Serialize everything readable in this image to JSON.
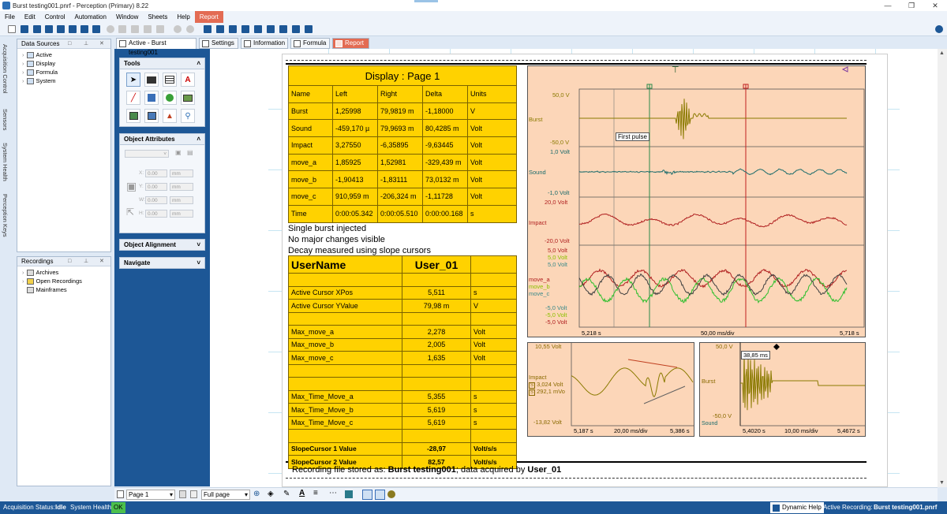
{
  "app": {
    "title": "Burst testing001.pnrf - Perception (Primary) 8.22",
    "menus": [
      "File",
      "Edit",
      "Control",
      "Automation",
      "Window",
      "Sheets",
      "Help",
      "Report"
    ]
  },
  "side_tabs": [
    "Acquisition Control",
    "Sensors",
    "System Health",
    "Perception Keys"
  ],
  "data_sources": {
    "title": "Data Sources",
    "items": [
      "Active",
      "Display",
      "Formula",
      "System"
    ]
  },
  "recordings": {
    "title": "Recordings",
    "items": [
      "Archives",
      "Open Recordings",
      "Mainframes"
    ]
  },
  "tools": {
    "title": "Tools"
  },
  "object_attributes": {
    "title": "Object Attributes",
    "x": "0.00",
    "y": "0.00",
    "w": "0.00",
    "h": "0.00",
    "unit": "mm",
    "xl": "X:",
    "yl": "Y:",
    "wl": "W:",
    "hl": "H:"
  },
  "object_alignment": {
    "title": "Object Alignment"
  },
  "navigate": {
    "title": "Navigate"
  },
  "tabs": [
    "Active - Burst testing001",
    "Settings",
    "Information",
    "Formula",
    "Report"
  ],
  "report": {
    "table1": {
      "title": "Display : Page 1",
      "headers": [
        "Name",
        "Left",
        "Right",
        "Delta",
        "Units"
      ],
      "rows": [
        [
          "Burst",
          "1,25998",
          "79,9819 m",
          "-1,18000",
          "V"
        ],
        [
          "Sound",
          "-459,170 µ",
          "79,9693 m",
          "80,4285 m",
          "Volt"
        ],
        [
          "Impact",
          "3,27550",
          "-6,35895",
          "-9,63445",
          "Volt"
        ],
        [
          "move_a",
          "1,85925",
          "1,52981",
          "-329,439 m",
          "Volt"
        ],
        [
          "move_b",
          "-1,90413",
          "-1,83111",
          "73,0132 m",
          "Volt"
        ],
        [
          "move_c",
          "910,959 m",
          "-206,324 m",
          "-1,11728",
          "Volt"
        ],
        [
          "Time",
          "0:00:05.342",
          "0:00:05.510",
          "0:00:00.168",
          "s"
        ]
      ]
    },
    "notes": [
      "Single burst injected",
      "No major changes visible",
      "Decay measured using slope cursors"
    ],
    "table2": {
      "h1": "UserName",
      "h2": "User_01",
      "rows": [
        [
          "",
          "",
          ""
        ],
        [
          "Active Cursor XPos",
          "5,511",
          "s"
        ],
        [
          "Active Cursor YValue",
          "79,98 m",
          "V"
        ],
        [
          "",
          "",
          ""
        ],
        [
          "Max_move_a",
          "2,278",
          "Volt"
        ],
        [
          "Max_move_b",
          "2,005",
          "Volt"
        ],
        [
          "Max_move_c",
          "1,635",
          "Volt"
        ],
        [
          "",
          "",
          ""
        ],
        [
          "",
          "",
          ""
        ],
        [
          "Max_Time_Move_a",
          "5,355",
          "s"
        ],
        [
          "Max_Time_Move_b",
          "5,619",
          "s"
        ],
        [
          "Max_Time_Move_c",
          "5,619",
          "s"
        ],
        [
          "",
          "",
          ""
        ],
        [
          "SlopeCursor 1 Value",
          "-28,97",
          "Volt/s/s"
        ],
        [
          "SlopeCursor 2 Value",
          "82,57",
          "Volt/s/s"
        ]
      ]
    },
    "footer": {
      "pre": "Recording file stored as: ",
      "file": "Burst testing001",
      "mid": "; data acquired by ",
      "user": "User_01"
    }
  },
  "main_plot": {
    "channels": [
      {
        "name": "Burst",
        "top": "50,0  V",
        "bottom": "-50,0  V",
        "color": "#8a7a00"
      },
      {
        "name": "Sound",
        "top": "1,0  Volt",
        "bottom": "-1,0  Volt",
        "color": "#1a6b6b"
      },
      {
        "name": "Impact",
        "top": "20,0  Volt",
        "bottom": "-20,0  Volt",
        "color": "#b02020"
      }
    ],
    "multi_top": [
      "5,0  Volt",
      "5,0  Volt",
      "5,0  Volt"
    ],
    "multi_bottom": [
      "-5,0  Volt",
      "-5,0  Volt",
      "-5,0  Volt"
    ],
    "multi_names": [
      "move_a",
      "move_b",
      "move_c"
    ],
    "multi_colors": [
      "#b02020",
      "#2dbf2d",
      "#404040"
    ],
    "label_colors": [
      "#b02020",
      "#8cc000",
      "#3a8a8a"
    ],
    "annotation": "First pulse",
    "x_left": "5,218  s",
    "x_mid": "50,00 ms/div",
    "x_right": "5,718  s"
  },
  "zoom1": {
    "top": "10,55  Volt",
    "bottom": "-13,82  Volt",
    "name": "Impact",
    "m1": "3,024  Volt",
    "m2": "292,1 mVo",
    "x_left": "5,187  s",
    "x_mid": "20,00 ms/div",
    "x_right": "5,386  s"
  },
  "zoom2": {
    "top": "50,0  V",
    "bottom": "-50,0  V",
    "name": "Burst",
    "cursor": "38,85 ms",
    "sub": "Sound",
    "x_left": "5,4020  s",
    "x_mid": "10,00 ms/div",
    "x_right": "5,4672  s"
  },
  "bottom": {
    "page": "Page 1",
    "zoom": "Full page"
  },
  "status": {
    "acq_label": "Acquisition Status:",
    "acq": "Idle",
    "sys_label": "System Health:",
    "sys": "OK",
    "help": "Dynamic Help",
    "rec_label": "Active Recording:",
    "rec": "Burst testing001.pnrf"
  }
}
